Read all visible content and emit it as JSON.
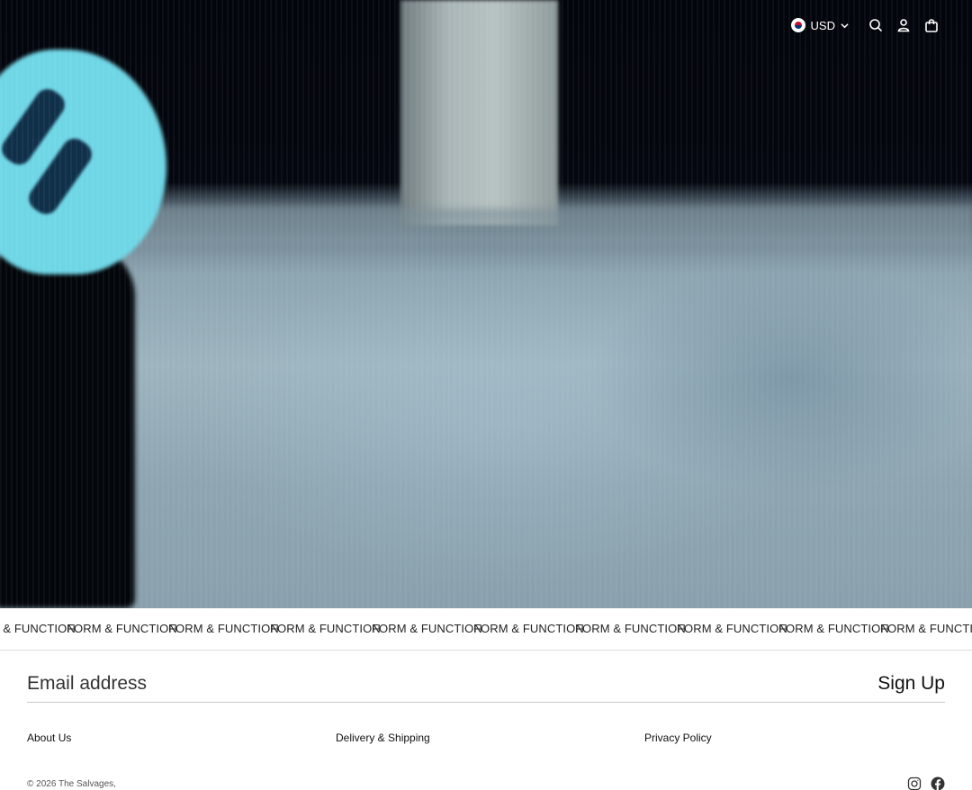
{
  "header": {
    "currency": "USD",
    "currency_flag_icon": "korea-flag-icon",
    "icons": [
      "search-icon",
      "account-icon",
      "cart-bag-icon"
    ]
  },
  "marquee": {
    "items": [
      "FORM & FUNCTION",
      "FORM & FUNCTION",
      "FORM & FUNCTION",
      "FORM & FUNCTION",
      "FORM & FUNCTION",
      "FORM & FUNCTION",
      "FORM & FUNCTION",
      "FORM & FUNCTION",
      "FORM & FUNCTION",
      "FORM & FUNCTION"
    ]
  },
  "newsletter": {
    "placeholder": "Email address",
    "button_label": "Sign Up"
  },
  "footer": {
    "links": [
      "About Us",
      "Delivery & Shipping",
      "Privacy Policy"
    ],
    "copyright": "© 2026 The Salvages,",
    "social_icons": [
      "instagram-icon",
      "facebook-icon"
    ]
  },
  "colors": {
    "text": "#111111",
    "divider": "#c9c9c9",
    "background": "#ffffff"
  }
}
